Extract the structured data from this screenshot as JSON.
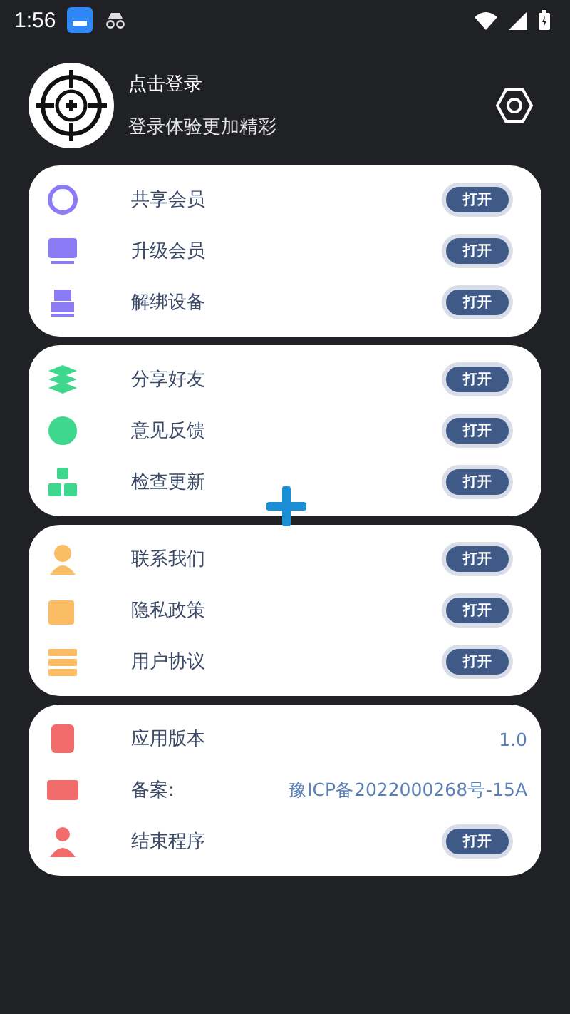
{
  "status_bar": {
    "time": "1:56"
  },
  "profile": {
    "title": "点击登录",
    "subtitle": "登录体验更加精彩"
  },
  "groups": [
    {
      "color": "#8b7cf6",
      "items": [
        {
          "label": "共享会员",
          "kind": "button",
          "action": "打开"
        },
        {
          "label": "升级会员",
          "kind": "button",
          "action": "打开"
        },
        {
          "label": "解绑设备",
          "kind": "button",
          "action": "打开"
        }
      ]
    },
    {
      "color": "#3fd68e",
      "items": [
        {
          "label": "分享好友",
          "kind": "button",
          "action": "打开"
        },
        {
          "label": "意见反馈",
          "kind": "button",
          "action": "打开"
        },
        {
          "label": "检查更新",
          "kind": "button",
          "action": "打开"
        }
      ]
    },
    {
      "color": "#fbbd63",
      "items": [
        {
          "label": "联系我们",
          "kind": "button",
          "action": "打开"
        },
        {
          "label": "隐私政策",
          "kind": "button",
          "action": "打开"
        },
        {
          "label": "用户协议",
          "kind": "button",
          "action": "打开"
        }
      ]
    },
    {
      "color": "#f26b6b",
      "items": [
        {
          "label": "应用版本",
          "kind": "value",
          "value": "1.0"
        },
        {
          "label": "备案:",
          "kind": "value",
          "value": "豫ICP备2022000268号-15A"
        },
        {
          "label": "结束程序",
          "kind": "button",
          "action": "打开"
        }
      ]
    }
  ]
}
